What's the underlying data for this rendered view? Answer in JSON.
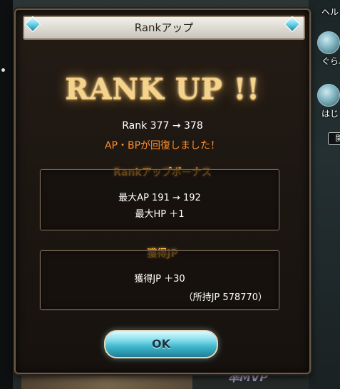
{
  "dialog": {
    "title": "Rankアップ",
    "banner": "RANK UP !!",
    "rank_change": "Rank 377 → 378",
    "recovery_notice": "AP・BPが回復しました！",
    "bonus": {
      "title": "Rankアップボーナス",
      "max_ap": "最大AP 191 → 192",
      "max_hp": "最大HP ＋1"
    },
    "jp": {
      "title": "獲得JP",
      "gained": "獲得JP ＋30",
      "held": "（所持JP 578770）"
    },
    "ok_label": "OK"
  },
  "sidebar": {
    "items": [
      {
        "label": "ヘル"
      },
      {
        "label": "ぐらぶ"
      },
      {
        "label": "はじ"
      }
    ],
    "open_label": "開"
  },
  "background": {
    "mvp_label": "準MVP"
  },
  "colors": {
    "accent_orange": "#ff8d2a",
    "section_gold": "#ffb33a",
    "ok_button": "#3fb6cc"
  }
}
